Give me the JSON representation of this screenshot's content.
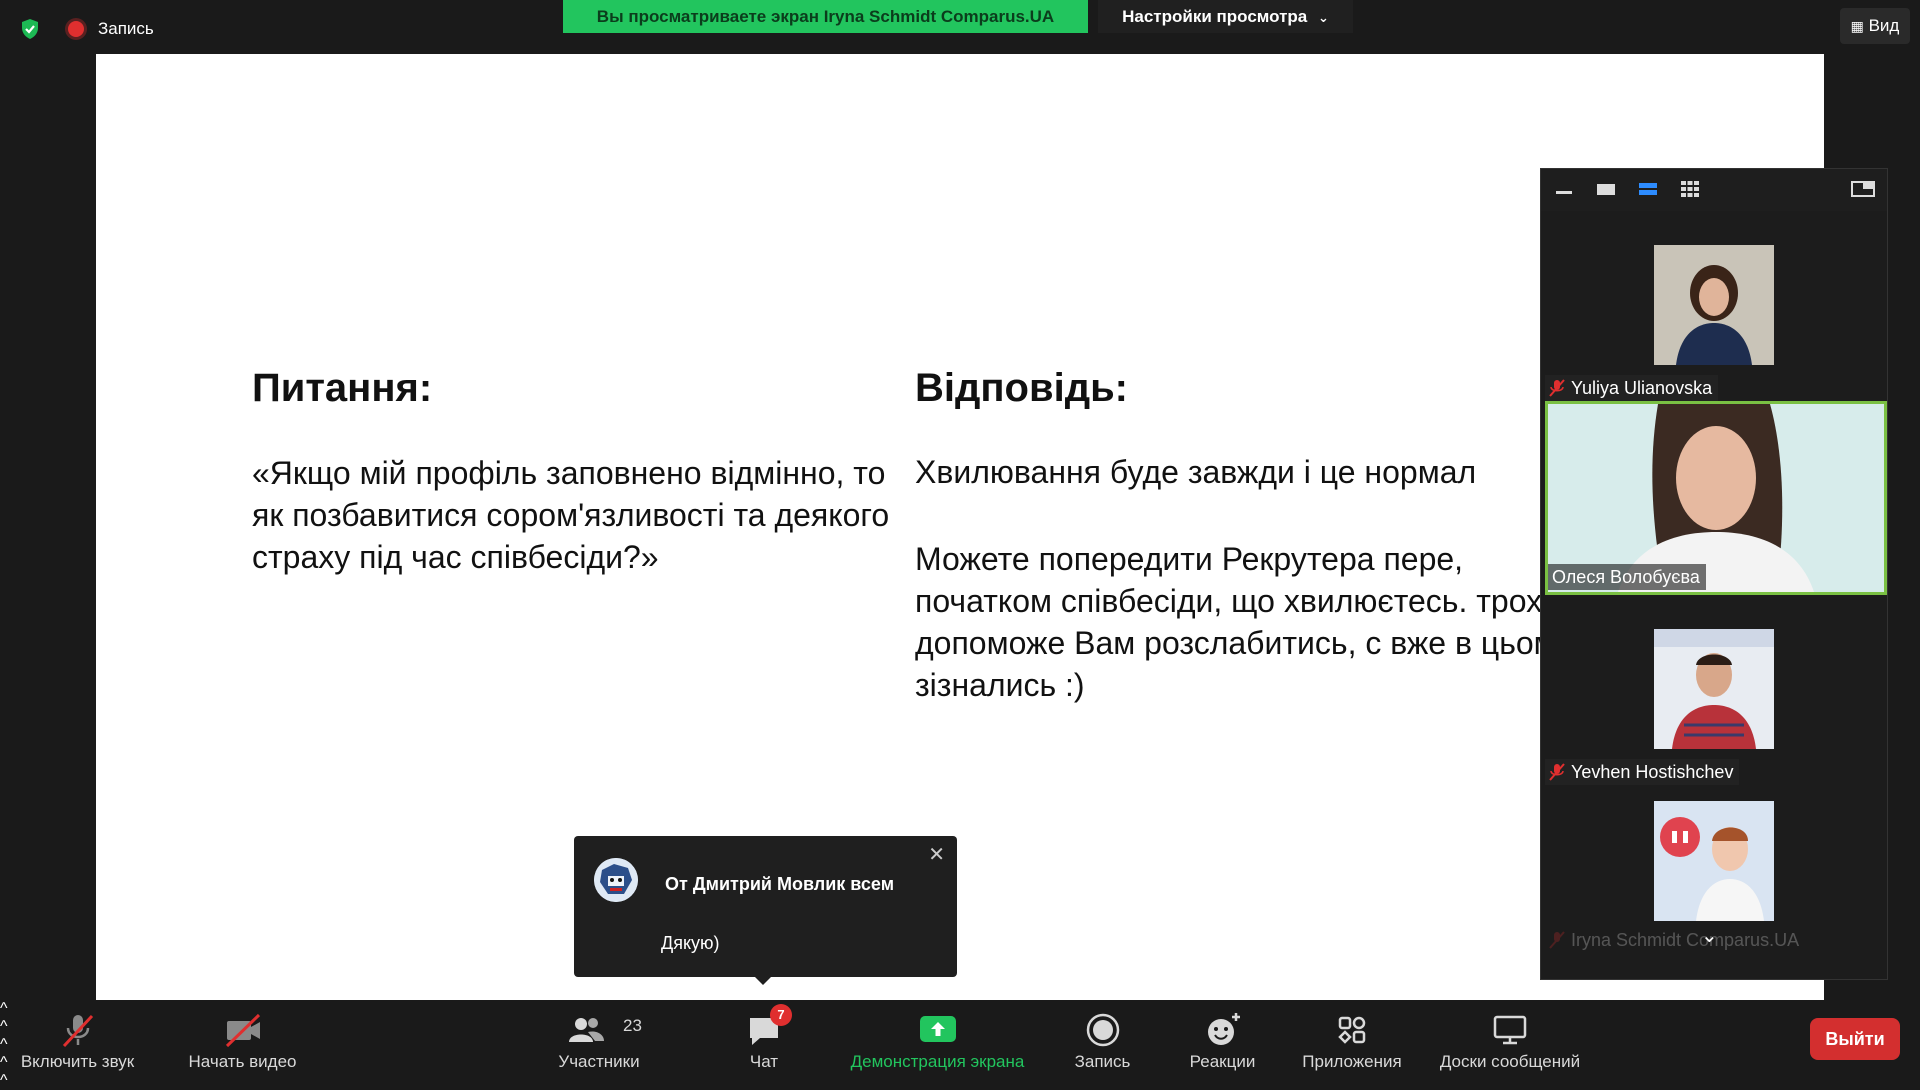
{
  "topbar": {
    "recording_label": "Запись",
    "viewing_banner": "Вы просматриваете экран Iryna Schmidt Comparus.UA",
    "view_settings_label": "Настройки просмотра",
    "view_label": "Вид"
  },
  "slide": {
    "question_title": "Питання:",
    "question_text": "«Якщо мій профіль заповнено відмінно, то як позбавитися сором'язливості та деякого страху під час співбесіди?»",
    "answer_title": "Відповідь:",
    "answer_text1": "Хвилювання буде завжди і це нормал",
    "answer_text2": "Можете попередити Рекрутера пере, початком співбесіди, що хвилюєтесь. трохи допоможе Вам розслабитись, с вже в цьому зізнались :)"
  },
  "chat_popup": {
    "from": "От Дмитрий Мовлик всем",
    "message": "Дякую)"
  },
  "participants": [
    {
      "name": "Yuliya Ulianovska",
      "muted": true
    },
    {
      "name": "Олеся Волобуєва",
      "muted": false,
      "active": true
    },
    {
      "name": "Yevhen Hostishchev",
      "muted": true
    },
    {
      "name": "Iryna Schmidt Comparus.UA",
      "muted": true
    }
  ],
  "toolbar": {
    "unmute_label": "Включить звук",
    "start_video_label": "Начать видео",
    "participants_label": "Участники",
    "participants_count": "23",
    "chat_label": "Чат",
    "chat_badge": "7",
    "share_label": "Демонстрация экрана",
    "record_label": "Запись",
    "reactions_label": "Реакции",
    "apps_label": "Приложения",
    "whiteboards_label": "Доски сообщений",
    "leave_label": "Выйти"
  },
  "colors": {
    "accent_green": "#22c55e",
    "leave_red": "#d32f2f",
    "active_speaker_border": "#7ac043"
  }
}
